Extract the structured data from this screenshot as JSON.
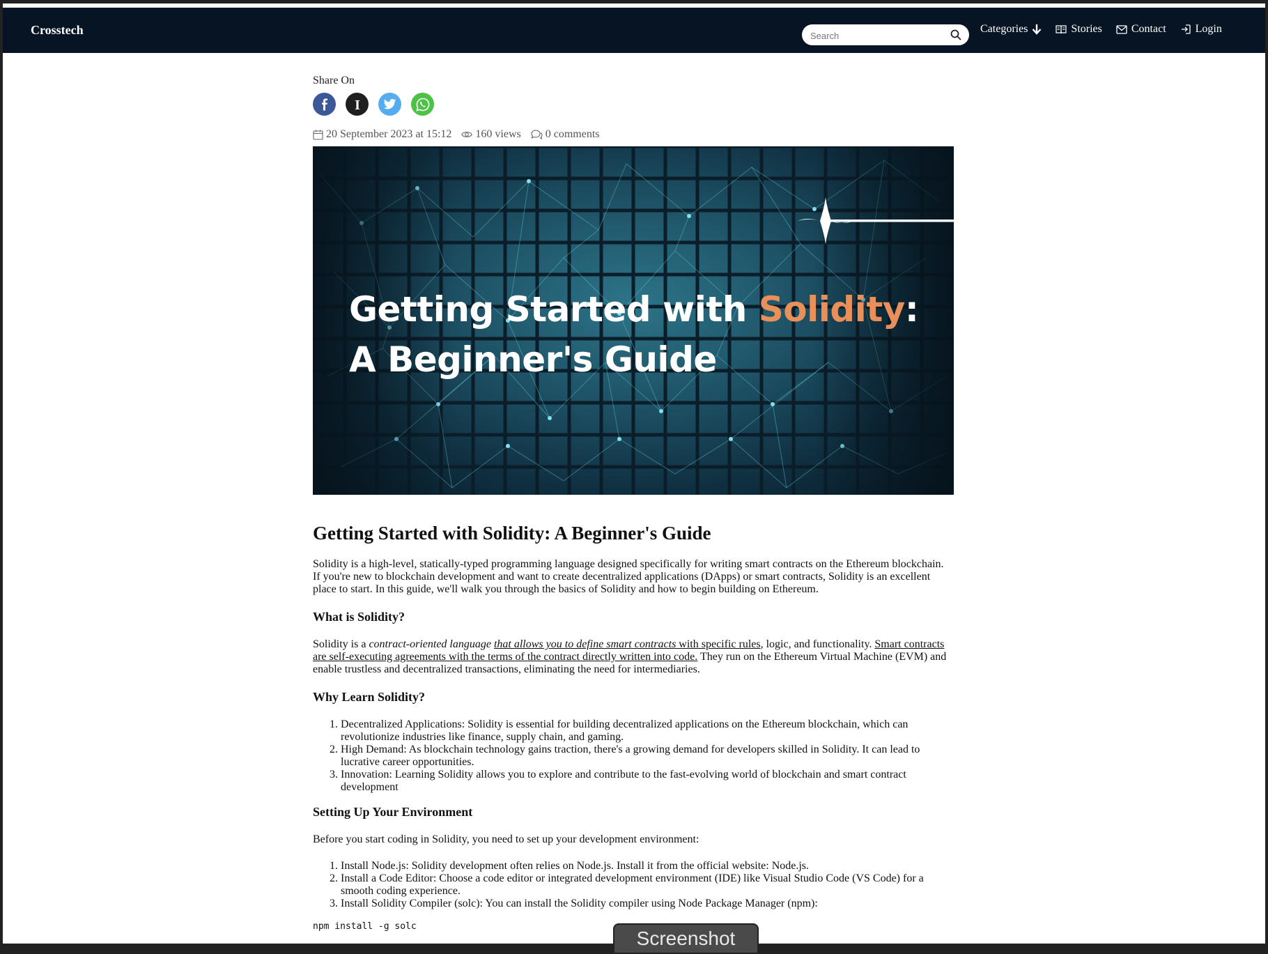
{
  "navbar": {
    "brand": "Crosstech",
    "search_placeholder": "Search",
    "links": {
      "categories": "Categories",
      "stories": "Stories",
      "contact": "Contact",
      "login": "Login"
    },
    "bg_color": "#071424"
  },
  "share": {
    "label": "Share On",
    "buttons": [
      "facebook",
      "instapaper",
      "twitter",
      "whatsapp"
    ]
  },
  "meta": {
    "date": "20 September 2023 at 15:12",
    "views": "160 views",
    "comments": "0 comments"
  },
  "hero": {
    "line1_part1": "Getting Started with ",
    "line1_accent": "Solidity",
    "line1_part2": ":",
    "line2": "A Beginner's Guide",
    "accent_color": "#e9905a"
  },
  "article": {
    "title": "Getting Started with Solidity: A Beginner's Guide",
    "intro": "Solidity is a high-level, statically-typed programming language designed specifically for writing smart contracts on the Ethereum blockchain. If you're new to blockchain development and want to create decentralized applications (DApps) or smart contracts, Solidity is an excellent place to start. In this guide, we'll walk you through the basics of Solidity and how to begin building on Ethereum.",
    "what": {
      "heading": "What is Solidity?",
      "p1_a": "Solidity is a ",
      "p1_em": "contract-oriented language ",
      "p1_em_u": "that allows you to define smart contracts",
      "p1_u1": " with specific rules",
      "p1_b": ", logic, and functionality. ",
      "p1_u2": "Smart contracts are self-executing agreements with the terms of the contract directly written into code.",
      "p1_c": " They run on the Ethereum Virtual Machine (EVM) and enable trustless and decentralized transactions, eliminating the need for intermediaries."
    },
    "why": {
      "heading": "Why Learn Solidity?",
      "items": [
        "Decentralized Applications: Solidity is essential for building decentralized applications on the Ethereum blockchain, which can revolutionize industries like finance, supply chain, and gaming.",
        "High Demand: As blockchain technology gains traction, there's a growing demand for developers skilled in Solidity. It can lead to lucrative career opportunities.",
        "Innovation: Learning Solidity allows you to explore and contribute to the fast-evolving world of blockchain and smart contract development"
      ]
    },
    "setup": {
      "heading": "Setting Up Your Environment",
      "intro": "Before you start coding in Solidity, you need to set up your development environment:",
      "items": [
        "Install Node.js: Solidity development often relies on Node.js. Install it from the official website: Node.js.",
        "Install a Code Editor: Choose a code editor or integrated development environment (IDE) like Visual Studio Code (VS Code) for a smooth coding experience.",
        "Install Solidity Compiler (solc): You can install the Solidity compiler using Node Package Manager (npm):"
      ],
      "code": "npm install -g solc"
    }
  },
  "overlay": {
    "screenshot_label": "Screenshot"
  }
}
